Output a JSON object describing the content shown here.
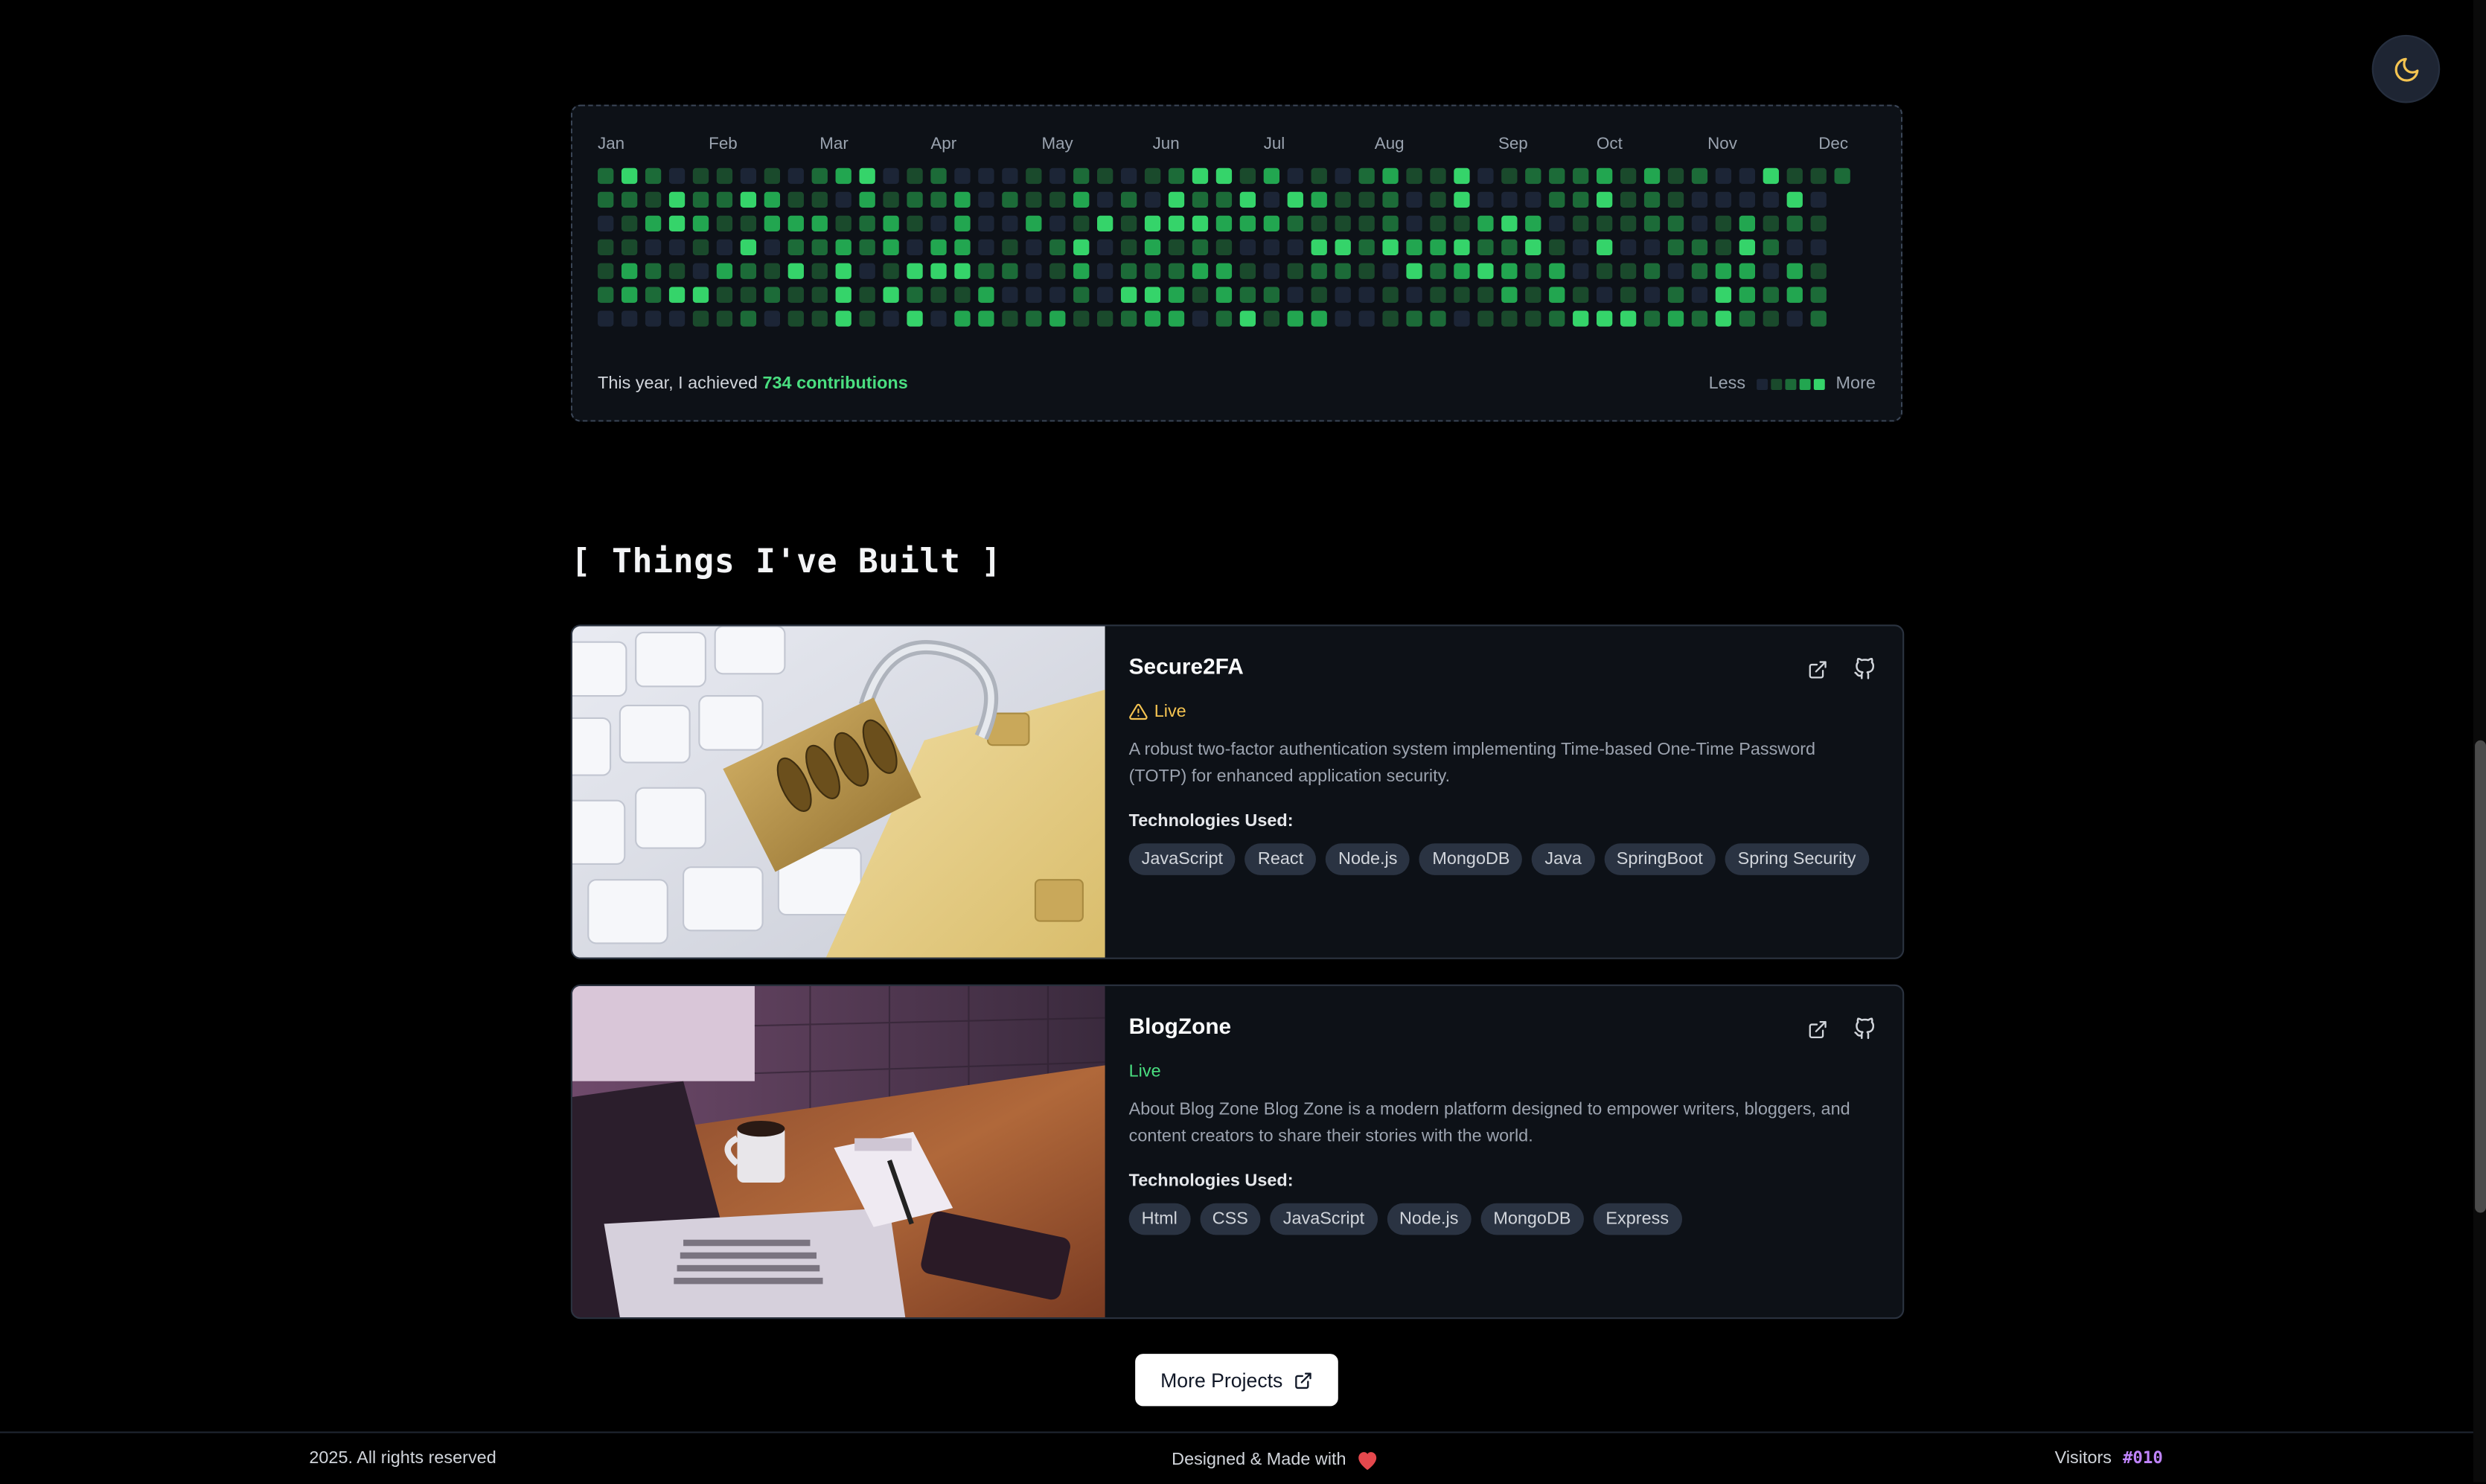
{
  "theme_toggle": {
    "icon": "moon-icon",
    "accent": "#f5c451"
  },
  "contributions": {
    "months": [
      "Jan",
      "Feb",
      "Mar",
      "Apr",
      "May",
      "Jun",
      "Jul",
      "Aug",
      "Sep",
      "Oct",
      "Nov",
      "Dec"
    ],
    "text_prefix": "This year, I achieved",
    "count_text": "734 contributions",
    "legend_less": "Less",
    "legend_more": "More",
    "colors": [
      "#1c2536",
      "#1a4a2c",
      "#1c6b38",
      "#22a650",
      "#35d46a"
    ]
  },
  "section": {
    "title": "[ Things I've Built ]"
  },
  "projects": [
    {
      "title": "Secure2FA",
      "status": "Live",
      "status_style": "warning",
      "description": "A robust two-factor authentication system implementing Time-based One-Time Password (TOTP) for enhanced application security.",
      "tech_label": "Technologies Used:",
      "tags": [
        "JavaScript",
        "React",
        "Node.js",
        "MongoDB",
        "Java",
        "SpringBoot",
        "Spring Security"
      ]
    },
    {
      "title": "BlogZone",
      "status": "Live",
      "status_style": "live",
      "description": "About Blog Zone Blog Zone is a modern platform designed to empower writers, bloggers, and content creators to share their stories with the world.",
      "tech_label": "Technologies Used:",
      "tags": [
        "Html",
        "CSS",
        "JavaScript",
        "Node.js",
        "MongoDB",
        "Express"
      ]
    }
  ],
  "more_projects": {
    "label": "More Projects"
  },
  "footer": {
    "copyright": "2025. All rights reserved",
    "designed": "Designed & Made with",
    "visitors_label": "Visitors",
    "visitors_count": "#010"
  }
}
